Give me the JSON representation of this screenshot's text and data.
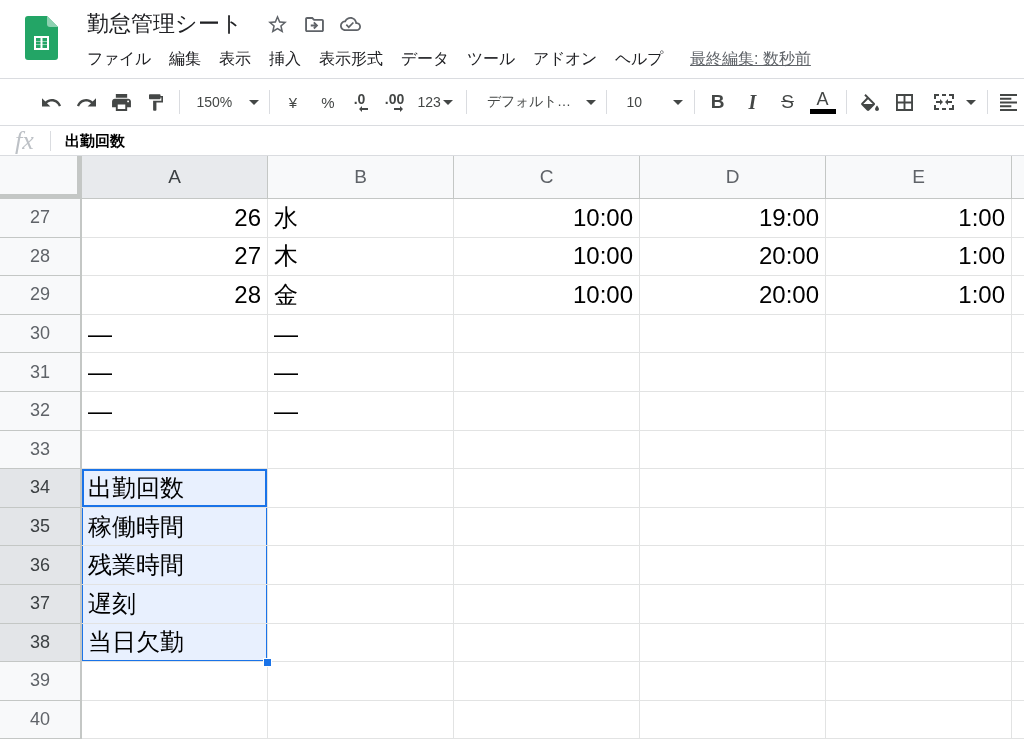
{
  "app": {
    "title": "勤怠管理シート",
    "menu": [
      "ファイル",
      "編集",
      "表示",
      "挿入",
      "表示形式",
      "データ",
      "ツール",
      "アドオン",
      "ヘルプ"
    ],
    "last_edit": "最終編集: 数秒前"
  },
  "toolbar": {
    "zoom": "150%",
    "currency": "¥",
    "percent": "%",
    "decimal_decrease": ".0",
    "decimal_increase": ".00",
    "number_format": "123",
    "font": "デフォルト…",
    "font_size": "10",
    "bold": "B",
    "italic": "I",
    "strikethrough": "S",
    "text_color": "A"
  },
  "formula_bar": {
    "label": "fx",
    "value": "出勤回数"
  },
  "columns": [
    {
      "label": "A",
      "selected": true
    },
    {
      "label": "B",
      "selected": false
    },
    {
      "label": "C",
      "selected": false
    },
    {
      "label": "D",
      "selected": false
    },
    {
      "label": "E",
      "selected": false
    }
  ],
  "rows": [
    {
      "number": "27",
      "selected": false,
      "cells": [
        {
          "text": "26",
          "kind": "number",
          "selected": false,
          "active": false
        },
        {
          "text": "水",
          "kind": "text",
          "selected": false,
          "active": false
        },
        {
          "text": "10:00",
          "kind": "number",
          "selected": false,
          "active": false
        },
        {
          "text": "19:00",
          "kind": "number",
          "selected": false,
          "active": false
        },
        {
          "text": "1:00",
          "kind": "number",
          "selected": false,
          "active": false
        }
      ]
    },
    {
      "number": "28",
      "selected": false,
      "cells": [
        {
          "text": "27",
          "kind": "number",
          "selected": false,
          "active": false
        },
        {
          "text": "木",
          "kind": "text",
          "selected": false,
          "active": false
        },
        {
          "text": "10:00",
          "kind": "number",
          "selected": false,
          "active": false
        },
        {
          "text": "20:00",
          "kind": "number",
          "selected": false,
          "active": false
        },
        {
          "text": "1:00",
          "kind": "number",
          "selected": false,
          "active": false
        }
      ]
    },
    {
      "number": "29",
      "selected": false,
      "cells": [
        {
          "text": "28",
          "kind": "number",
          "selected": false,
          "active": false
        },
        {
          "text": "金",
          "kind": "text",
          "selected": false,
          "active": false
        },
        {
          "text": "10:00",
          "kind": "number",
          "selected": false,
          "active": false
        },
        {
          "text": "20:00",
          "kind": "number",
          "selected": false,
          "active": false
        },
        {
          "text": "1:00",
          "kind": "number",
          "selected": false,
          "active": false
        }
      ]
    },
    {
      "number": "30",
      "selected": false,
      "cells": [
        {
          "text": "—",
          "kind": "text",
          "selected": false,
          "active": false
        },
        {
          "text": "—",
          "kind": "text",
          "selected": false,
          "active": false
        }
      ]
    },
    {
      "number": "31",
      "selected": false,
      "cells": [
        {
          "text": "—",
          "kind": "text",
          "selected": false,
          "active": false
        },
        {
          "text": "—",
          "kind": "text",
          "selected": false,
          "active": false
        }
      ]
    },
    {
      "number": "32",
      "selected": false,
      "cells": [
        {
          "text": "—",
          "kind": "text",
          "selected": false,
          "active": false
        },
        {
          "text": "—",
          "kind": "text",
          "selected": false,
          "active": false
        }
      ]
    },
    {
      "number": "33",
      "selected": false
    },
    {
      "number": "34",
      "selected": true,
      "cells": [
        {
          "text": "出勤回数",
          "kind": "text",
          "selected": true,
          "active": true
        }
      ]
    },
    {
      "number": "35",
      "selected": true,
      "cells": [
        {
          "text": "稼働時間",
          "kind": "text",
          "selected": true,
          "active": false
        }
      ]
    },
    {
      "number": "36",
      "selected": true,
      "cells": [
        {
          "text": "残業時間",
          "kind": "text",
          "selected": true,
          "active": false
        }
      ]
    },
    {
      "number": "37",
      "selected": true,
      "cells": [
        {
          "text": "遅刻",
          "kind": "text",
          "selected": true,
          "active": false
        }
      ]
    },
    {
      "number": "38",
      "selected": true,
      "cells": [
        {
          "text": "当日欠勤",
          "kind": "text",
          "selected": true,
          "active": false
        }
      ]
    },
    {
      "number": "39",
      "selected": false
    },
    {
      "number": "40",
      "selected": false
    }
  ]
}
